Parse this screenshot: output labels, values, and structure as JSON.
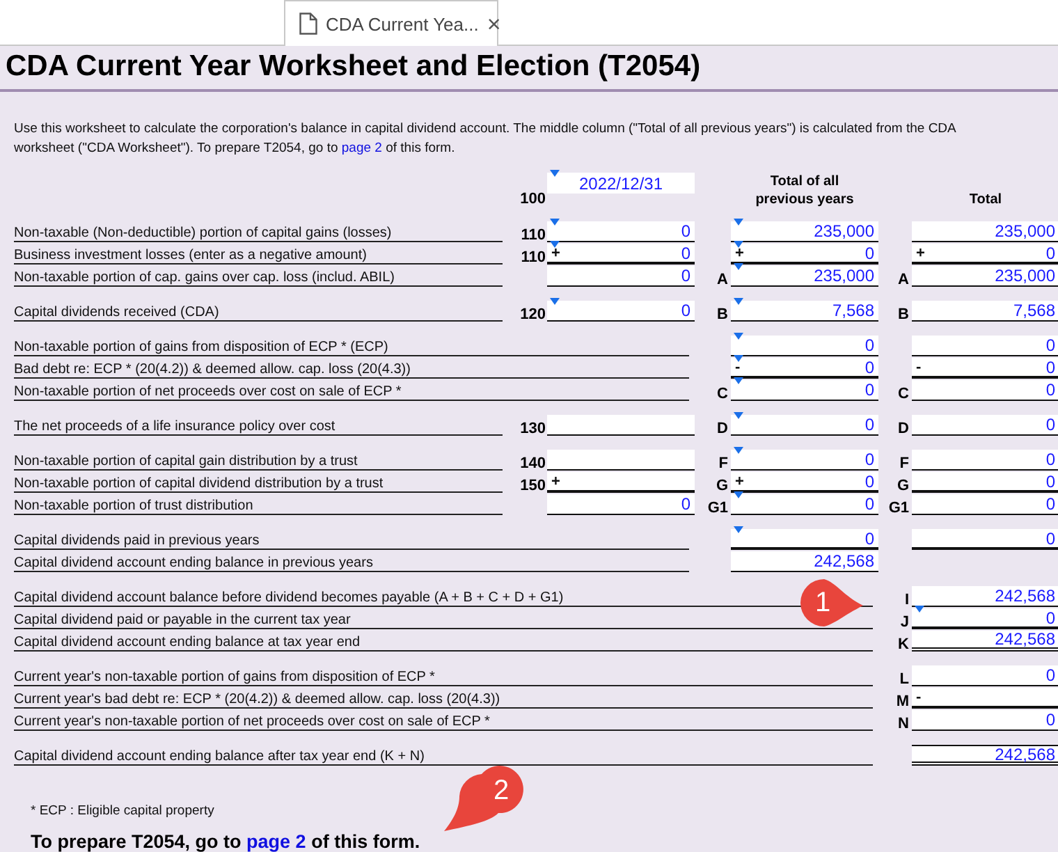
{
  "tab": {
    "title": "CDA Current Yea...",
    "close": "×"
  },
  "title": "CDA Current Year Worksheet and Election (T2054)",
  "intro": {
    "before": "Use this worksheet to calculate the corporation's balance in capital dividend account. The middle column (\"Total of all previous years\") is calculated from the CDA worksheet (\"CDA Worksheet\"). To prepare T2054, go to ",
    "link": "page 2",
    "after": " of this form."
  },
  "header": {
    "code": "100",
    "date": {
      "value": "2022/12/31",
      "marker": true
    },
    "column_2": "Total of all previous years",
    "column_3": "Total"
  },
  "sections": [
    {
      "rows": [
        {
          "label": "Non-taxable (Non-deductible) portion of capital gains (losses)",
          "code": "110",
          "f1": {
            "value": "0",
            "marker": true
          },
          "f2": {
            "value": "235,000",
            "marker": true
          },
          "f3": {
            "value": "235,000"
          }
        },
        {
          "label": "Business investment losses (enter as a negative amount)",
          "code": "110",
          "f1": {
            "sign": "+",
            "value": "0",
            "marker": true,
            "heavy": true
          },
          "f2": {
            "sign": "+",
            "value": "0",
            "marker": true,
            "heavy": true
          },
          "f3": {
            "sign": "+",
            "value": "0",
            "heavy": true
          }
        },
        {
          "label": "Non-taxable portion of cap. gains over cap. loss (includ. ABIL)",
          "f1": {
            "value": "0"
          },
          "l2": "A",
          "f2": {
            "value": "235,000",
            "marker": true
          },
          "l3": "A",
          "f3": {
            "value": "235,000"
          }
        }
      ]
    },
    {
      "rows": [
        {
          "label": "Capital dividends received (CDA)",
          "code": "120",
          "f1": {
            "value": "0",
            "marker": true
          },
          "l2": "B",
          "f2": {
            "value": "7,568",
            "marker": true
          },
          "l3": "B",
          "f3": {
            "value": "7,568"
          }
        }
      ]
    },
    {
      "rows": [
        {
          "label": "Non-taxable portion of gains from disposition of ECP * (ECP)",
          "f2": {
            "value": "0",
            "marker": true
          },
          "f3": {
            "value": "0"
          }
        },
        {
          "label": "Bad debt re: ECP * (20(4.2)) & deemed allow. cap. loss (20(4.3))",
          "f2": {
            "sign": "-",
            "value": "0",
            "marker": true,
            "heavy": true
          },
          "f3": {
            "sign": "-",
            "value": "0",
            "heavy": true
          }
        },
        {
          "label": "Non-taxable portion of net proceeds over cost on sale of ECP *",
          "l2": "C",
          "f2": {
            "value": "0",
            "marker": true
          },
          "l3": "C",
          "f3": {
            "value": "0"
          }
        }
      ]
    },
    {
      "rows": [
        {
          "label": "The net proceeds of a life insurance policy over cost",
          "code": "130",
          "f1": {},
          "l2": "D",
          "f2": {
            "value": "0",
            "marker": true
          },
          "l3": "D",
          "f3": {
            "value": "0"
          }
        }
      ]
    },
    {
      "rows": [
        {
          "label": "Non-taxable portion of capital gain distribution by a trust",
          "code": "140",
          "f1": {},
          "l2": "F",
          "f2": {
            "value": "0",
            "marker": true
          },
          "l3": "F",
          "f3": {
            "value": "0"
          }
        },
        {
          "label": "Non-taxable portion of capital dividend distribution by a trust",
          "code": "150",
          "f1": {
            "sign": "+",
            "heavy": true
          },
          "l2": "G",
          "f2": {
            "sign": "+",
            "value": "0",
            "heavy": true
          },
          "l3": "G",
          "f3": {
            "value": "0",
            "heavy": true
          }
        },
        {
          "label": "Non-taxable portion of trust distribution",
          "f1": {
            "value": "0"
          },
          "l2": "G1",
          "f2": {
            "value": "0",
            "marker": true
          },
          "l3": "G1",
          "f3": {
            "value": "0"
          }
        }
      ]
    },
    {
      "rows": [
        {
          "label": "Capital dividends paid in previous years",
          "f2": {
            "value": "0",
            "marker": true,
            "heavy": true
          },
          "f3": {
            "value": "0",
            "heavy": true
          }
        },
        {
          "label": "Capital dividend account ending balance in previous years",
          "f2": {
            "value": "242,568"
          }
        }
      ]
    },
    {
      "rows": [
        {
          "label": "Capital dividend account balance before dividend becomes payable (A + B + C + D + G1)",
          "l3": "I",
          "f3": {
            "value": "242,568"
          }
        },
        {
          "label": "Capital dividend paid or payable in the current tax year",
          "l3": "J",
          "f3": {
            "value": "0",
            "marker": true,
            "heavy": true
          }
        },
        {
          "label": "Capital dividend account ending balance at tax year end",
          "l3": "K",
          "f3": {
            "value": "242,568",
            "double": true
          }
        }
      ]
    },
    {
      "rows": [
        {
          "label": "Current year's non-taxable portion of gains from disposition of ECP *",
          "l3": "L",
          "f3": {
            "value": "0"
          }
        },
        {
          "label": "Current year's bad debt re: ECP * (20(4.2)) & deemed allow. cap. loss (20(4.3))",
          "l3": "M",
          "f3": {
            "sign": "-",
            "heavy": true
          }
        },
        {
          "label": "Current year's non-taxable portion of net proceeds over cost on sale of ECP *",
          "l3": "N",
          "f3": {
            "value": "0"
          }
        }
      ]
    },
    {
      "rows": [
        {
          "label": "Capital dividend account ending balance after tax year end (K + N)",
          "f3": {
            "value": "242,568",
            "double": true,
            "boxed": true
          }
        }
      ]
    }
  ],
  "footnote": "* ECP : Eligible capital property",
  "closing": {
    "before": "To prepare T2054, go to ",
    "link": "page 2",
    "after": " of this form."
  },
  "callouts": [
    {
      "number": "1",
      "kind": "right"
    },
    {
      "number": "2",
      "kind": "down"
    }
  ]
}
